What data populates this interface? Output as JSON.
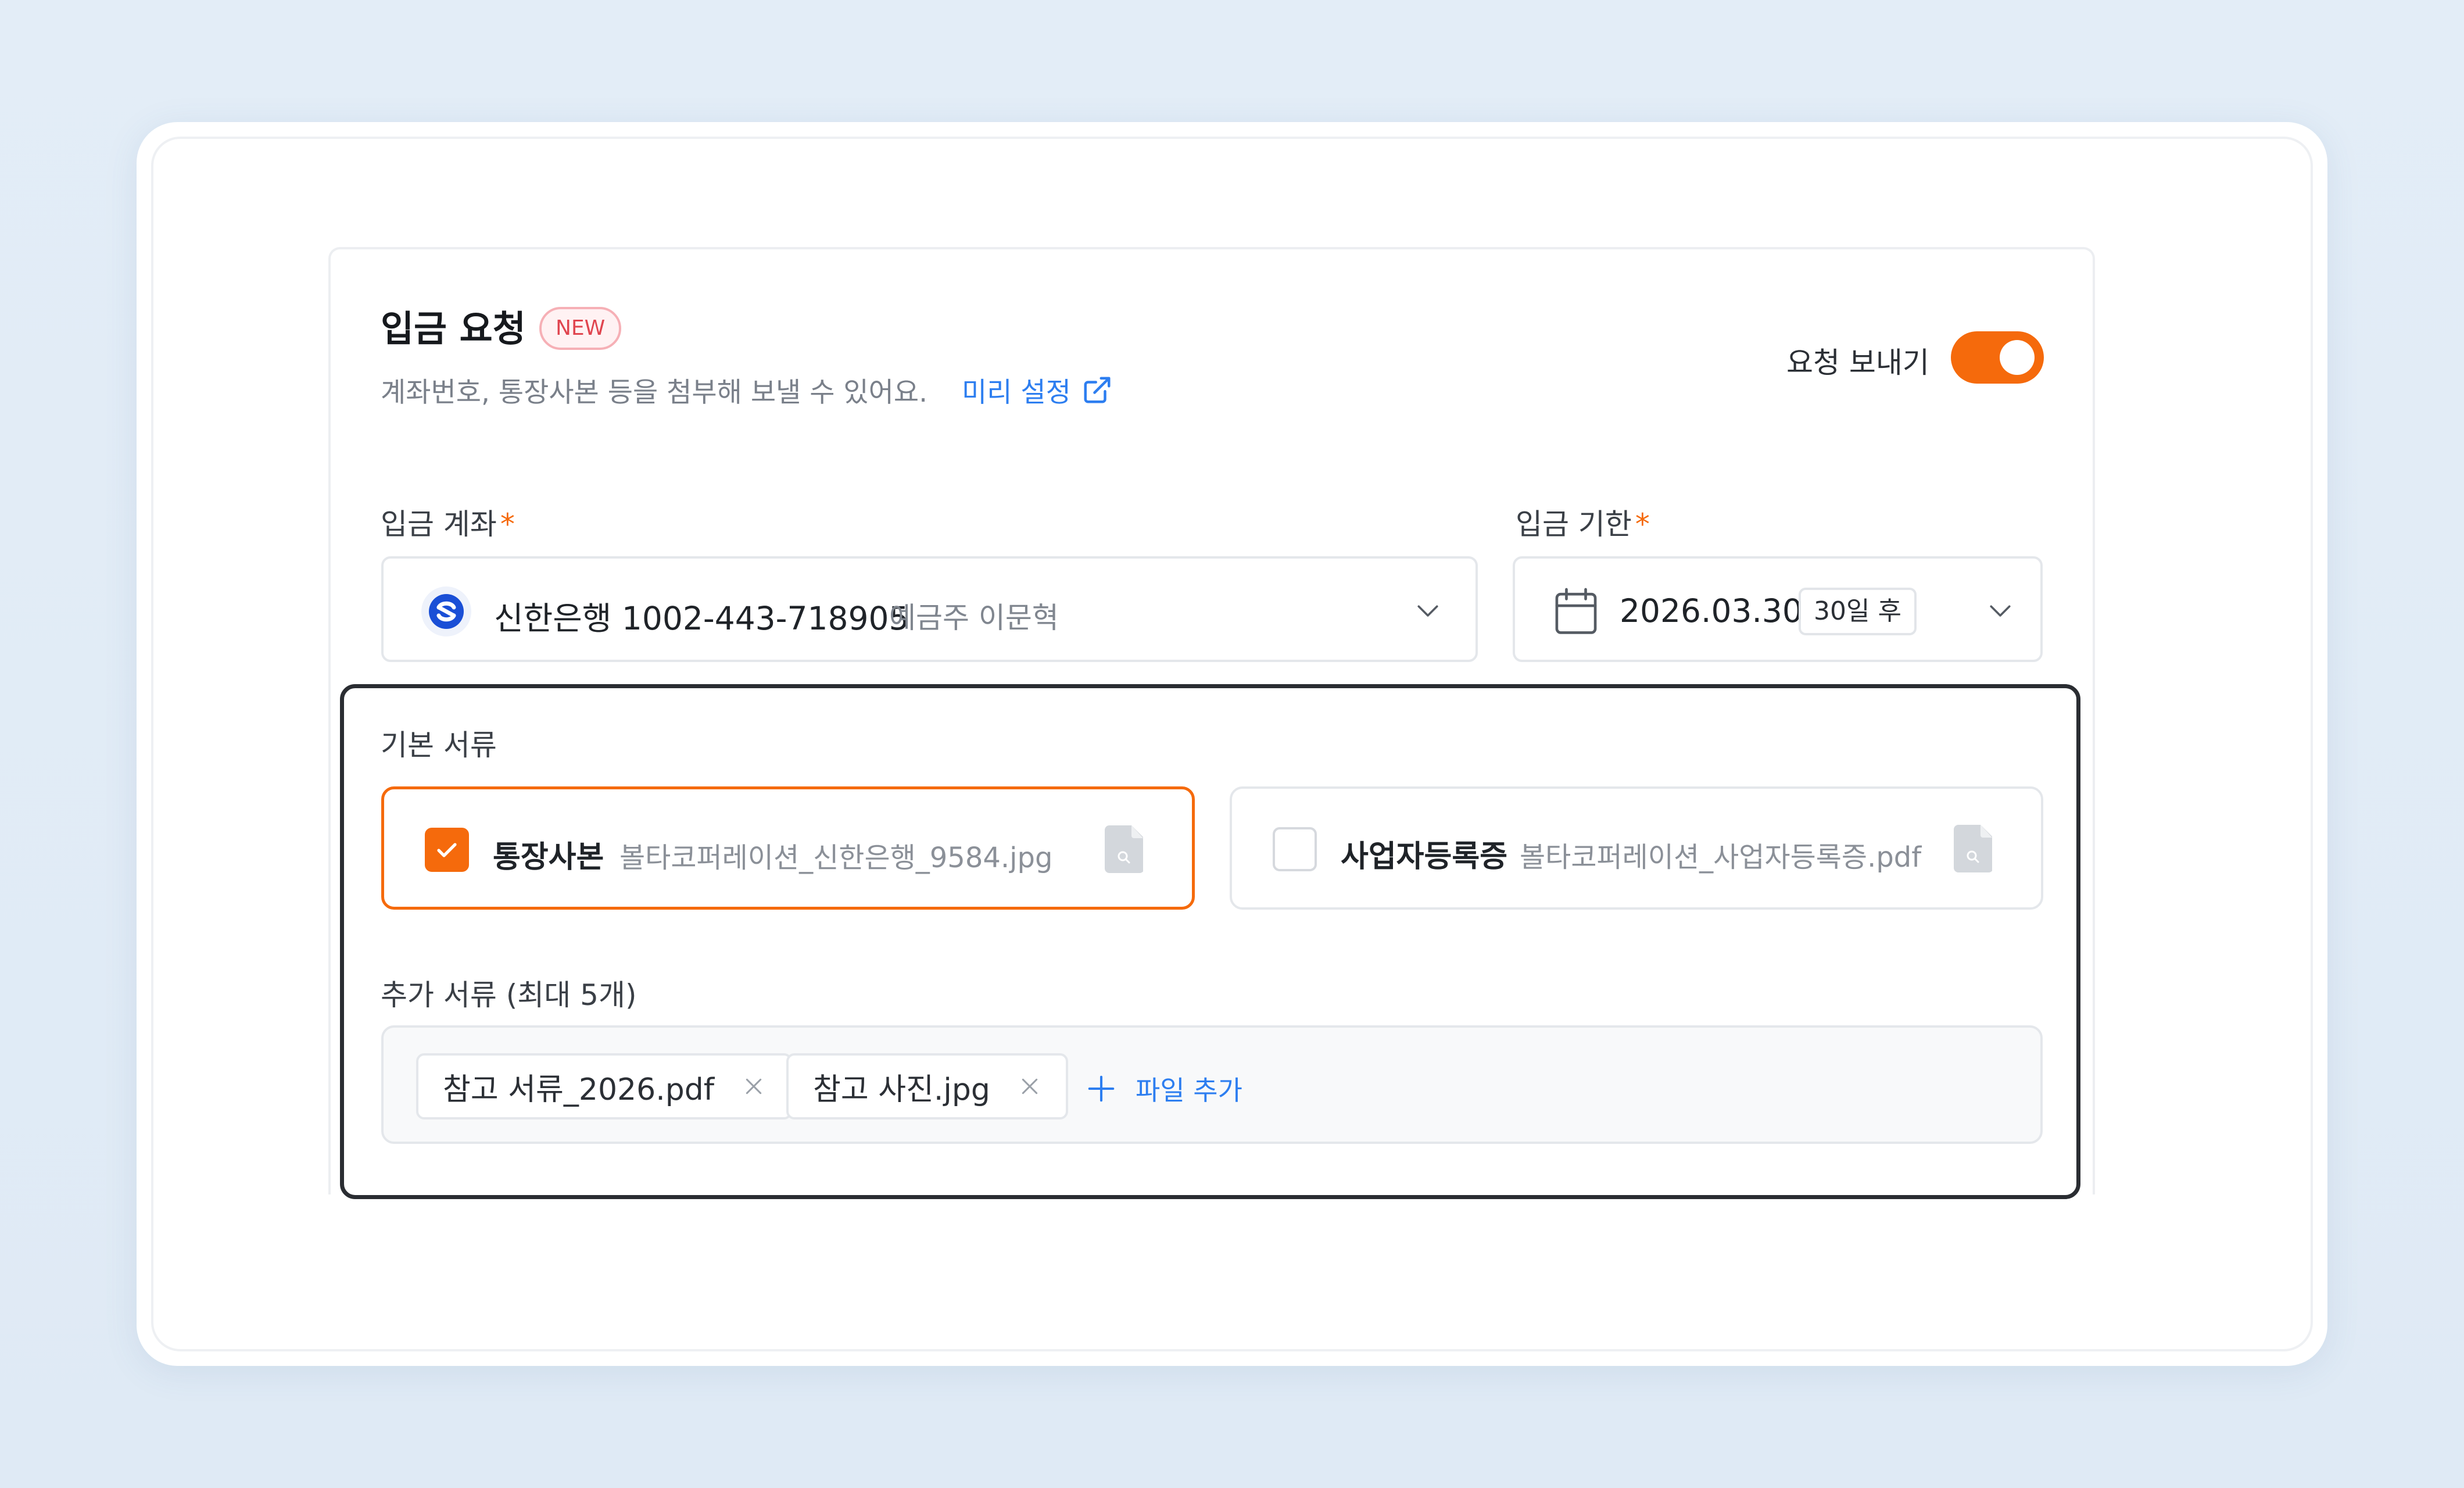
{
  "header": {
    "title": "입금 요청",
    "badge": "NEW",
    "description": "계좌번호, 통장사본 등을 첨부해 보낼 수 있어요.",
    "preset_link": "미리 설정",
    "toggle_label": "요청 보내기",
    "toggle_on": true
  },
  "account": {
    "label": "입금 계좌",
    "required_mark": "*",
    "value": "신한은행 1002-443-718905",
    "holder": "예금주 이문혁"
  },
  "due": {
    "label": "입금 기한",
    "required_mark": "*",
    "date": "2026.03.30",
    "relative": "30일 후"
  },
  "basic_docs": {
    "label": "기본 서류",
    "items": [
      {
        "name": "통장사본",
        "file": "볼타코퍼레이션_신한은행_9584.jpg",
        "checked": true
      },
      {
        "name": "사업자등록증",
        "file": "볼타코퍼레이션_사업자등록증.pdf",
        "checked": false
      }
    ]
  },
  "extra_docs": {
    "label": "추가 서류 (최대 5개)",
    "files": [
      "참고 서류_2026.pdf",
      "참고 사진.jpg"
    ],
    "add_label": "파일 추가"
  },
  "colors": {
    "accent": "#f56a0c",
    "link": "#2d7ef0",
    "badge_text": "#e0454f"
  }
}
